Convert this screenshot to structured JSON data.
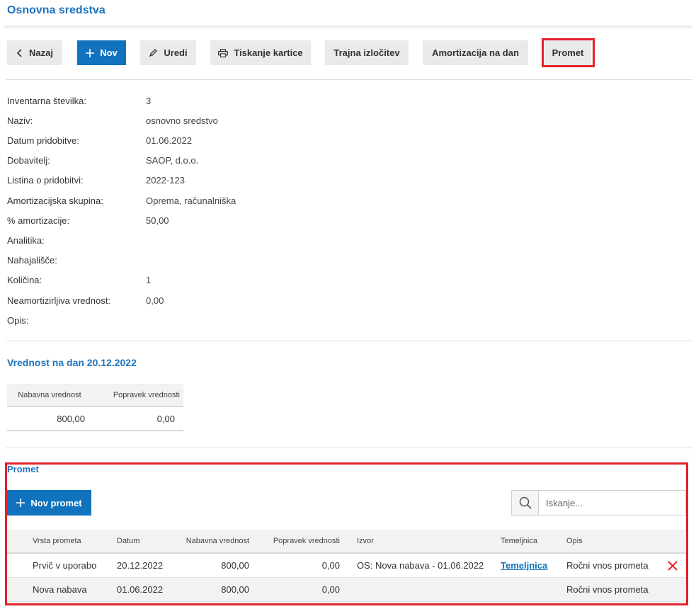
{
  "page": {
    "title": "Osnovna sredstva"
  },
  "toolbar": {
    "back_label": "Nazaj",
    "new_label": "Nov",
    "edit_label": "Uredi",
    "print_label": "Tiskanje kartice",
    "retire_label": "Trajna izločitev",
    "depreciation_label": "Amortizacija na dan",
    "transactions_label": "Promet"
  },
  "fields": [
    {
      "label": "Inventarna številka:",
      "value": "3"
    },
    {
      "label": "Naziv:",
      "value": "osnovno sredstvo"
    },
    {
      "label": "Datum pridobitve:",
      "value": "01.06.2022"
    },
    {
      "label": "Dobavitelj:",
      "value": "SAOP, d.o.o."
    },
    {
      "label": "Listina o pridobitvi:",
      "value": "2022-123"
    },
    {
      "label": "Amortizacijska skupina:",
      "value": "Oprema, računalniška"
    },
    {
      "label": "% amortizacije:",
      "value": "50,00"
    },
    {
      "label": "Analitika:",
      "value": ""
    },
    {
      "label": "Nahajališče:",
      "value": ""
    },
    {
      "label": "Količina:",
      "value": "1"
    },
    {
      "label": "Neamortizirljiva vrednost:",
      "value": "0,00"
    },
    {
      "label": "Opis:",
      "value": ""
    }
  ],
  "value_section": {
    "title": "Vrednost na dan 20.12.2022",
    "headers": [
      "Nabavna vrednost",
      "Popravek vrednosti"
    ],
    "row": [
      "800,00",
      "0,00"
    ]
  },
  "promet": {
    "title": "Promet",
    "new_label": "Nov promet",
    "search_placeholder": "Iskanje...",
    "headers": [
      "Vrsta prometa",
      "Datum",
      "Nabavna vrednost",
      "Popravek vrednosti",
      "Izvor",
      "Temeljnica",
      "Opis"
    ],
    "rows": [
      {
        "type": "Prvič v uporabo",
        "date": "20.12.2022",
        "purchase": "800,00",
        "correction": "0,00",
        "source": "OS: Nova nabava - 01.06.2022",
        "journal": "Temeljnica",
        "description": "Ročni vnos prometa"
      },
      {
        "type": "Nova nabava",
        "date": "01.06.2022",
        "purchase": "800,00",
        "correction": "0,00",
        "source": "",
        "journal": "",
        "description": "Ročni vnos prometa"
      }
    ]
  },
  "colors": {
    "accent": "#1173be",
    "title": "#1e73be",
    "highlight": "#e3202b",
    "delete": "#e3202b"
  }
}
